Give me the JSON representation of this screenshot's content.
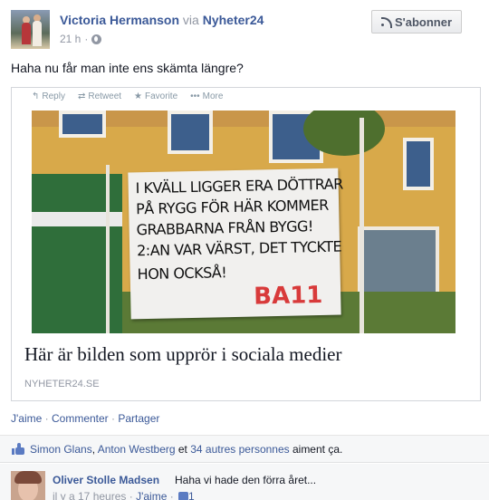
{
  "post": {
    "author": "Victoria Hermanson",
    "via_label": "via",
    "page": "Nyheter24",
    "time": "21 h",
    "separator": "·",
    "subscribe_label": "S'abonner",
    "status": "Haha nu får man inte ens skämta längre?"
  },
  "link_card": {
    "tweet_actions": [
      "Reply",
      "Retweet",
      "Favorite",
      "More"
    ],
    "banner_lines": [
      "I KVÄLL LIGGER ERA DÖTTRAR",
      "PÅ RYGG FÖR HÄR KOMMER",
      "GRABBARNA FRÅN BYGG!",
      "2:AN VAR VÄRST, DET TYCKTE",
      "HON OCKSÅ!"
    ],
    "banner_tag": "BA11",
    "title": "Här är bilden som upprör i sociala medier",
    "domain": "NYHETER24.SE"
  },
  "actions": {
    "like": "J'aime",
    "comment": "Commenter",
    "share": "Partager",
    "dot": " · "
  },
  "likes": {
    "person1": "Simon Glans",
    "sep1": ", ",
    "person2": "Anton Westberg",
    "and": " et ",
    "others": "34 autres personnes",
    "suffix": " aiment ça."
  },
  "comment": {
    "author": "Oliver Stolle Madsen",
    "text": "Haha vi hade den förra året...",
    "time": "il y a 17 heures",
    "like": "J'aime",
    "like_count": "1"
  },
  "colors": {
    "link": "#3b5998",
    "muted": "#9197a3",
    "panel": "#f6f7f8"
  }
}
